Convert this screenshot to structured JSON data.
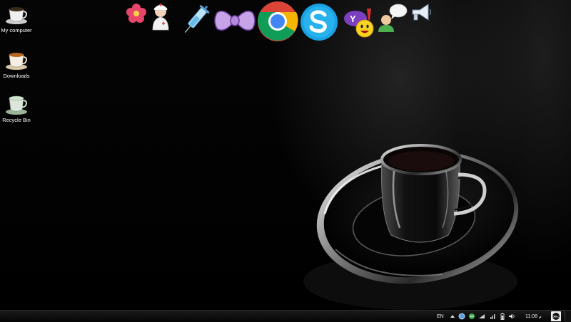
{
  "desktop": {
    "icons": [
      {
        "label": "My computer",
        "icon": "coffee-cup-icon"
      },
      {
        "label": "Downloads",
        "icon": "coffee-cup-icon"
      },
      {
        "label": "Recycle Bin",
        "icon": "glass-cup-icon"
      }
    ]
  },
  "dock": {
    "items": [
      {
        "icon": "flower-icon"
      },
      {
        "icon": "nurse-icon"
      },
      {
        "icon": "syringe-icon"
      },
      {
        "icon": "bow-icon"
      },
      {
        "icon": "chrome-icon"
      },
      {
        "icon": "skype-icon"
      },
      {
        "icon": "yahoo-messenger-icon"
      },
      {
        "icon": "chat-user-icon"
      },
      {
        "icon": "megaphone-icon"
      }
    ]
  },
  "taskbar": {
    "language": "EN",
    "clock": "11:08",
    "clock_suffix": "م",
    "tray_icons": [
      "show-hidden-icons-icon",
      "network-globe-icon",
      "connection-icon",
      "wifi-icon",
      "signal-icon",
      "battery-icon",
      "volume-icon"
    ],
    "oem_badge": "DELL"
  }
}
